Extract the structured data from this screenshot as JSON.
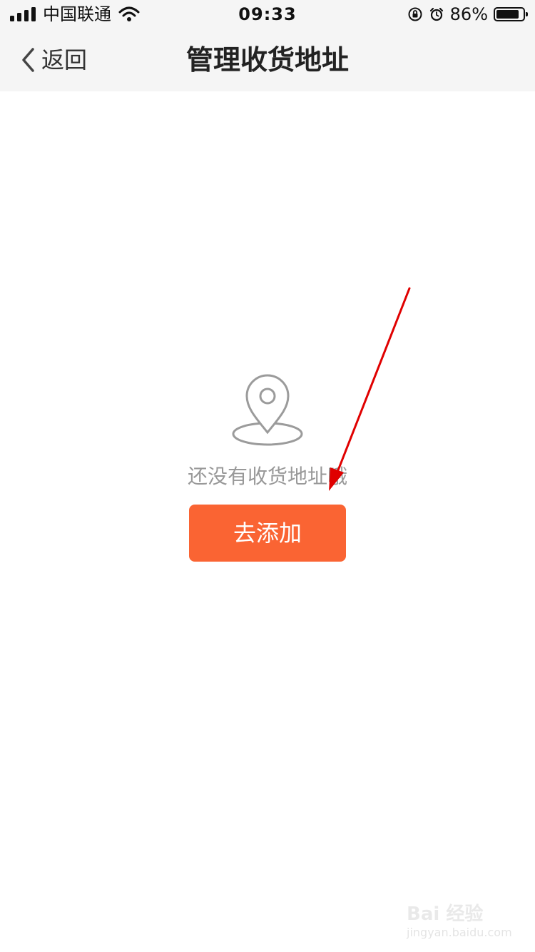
{
  "status_bar": {
    "carrier": "中国联通",
    "time": "09:33",
    "battery_percent": "86%",
    "battery_level": 0.86,
    "signal_level": 4,
    "icons": [
      "signal-icon",
      "wifi-icon",
      "orientation-lock-icon",
      "alarm-icon",
      "battery-icon"
    ]
  },
  "nav": {
    "back_label": "返回",
    "title": "管理收货地址"
  },
  "empty_state": {
    "icon": "location-pin-icon",
    "message": "还没有收货地址哦",
    "button_label": "去添加"
  },
  "annotation": {
    "type": "red-arrow",
    "color": "#e00000",
    "points_to": "add-button"
  },
  "colors": {
    "button": "#fa6433",
    "nav_background": "#f5f5f5",
    "empty_text": "#999999"
  },
  "watermark": {
    "text": "Bai 经验",
    "subtext": "jingyan.baidu.com"
  }
}
